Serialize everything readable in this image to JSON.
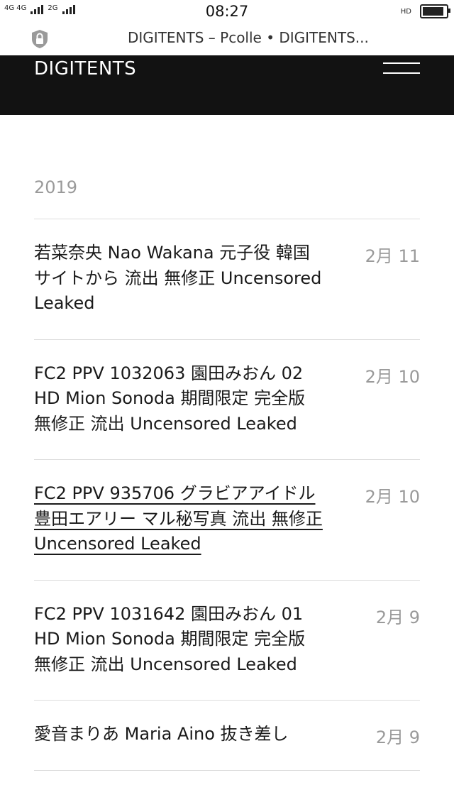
{
  "status_bar": {
    "network_left": "4G 4G",
    "network_right": "2G",
    "time": "08:27",
    "hd_label": "HD"
  },
  "browser": {
    "tab_title": "DIGITENTS – Pcolle • DIGITENTS..."
  },
  "site": {
    "logo": "DIGITENTS",
    "menu_icon": "hamburger-menu-icon"
  },
  "archive": {
    "year": "2019",
    "entries": [
      {
        "title": "若菜奈央 Nao Wakana 元子役 韓国サイトから 流出 無修正 Uncensored Leaked",
        "date": "2月 11"
      },
      {
        "title": "FC2 PPV 1032063 園田みおん 02 HD Mion Sonoda 期間限定 完全版 無修正 流出 Uncensored Leaked",
        "date": "2月 10"
      },
      {
        "title": "FC2 PPV 935706 グラビアアイドル 豊田エアリー マル秘写真 流出 無修正 Uncensored Leaked",
        "date": "2月 10"
      },
      {
        "title": "FC2 PPV 1031642 園田みおん 01 HD Mion Sonoda 期間限定 完全版 無修正 流出 Uncensored Leaked",
        "date": "2月 9"
      },
      {
        "title": "愛音まりあ Maria Aino 抜き差し",
        "date": "2月 9"
      }
    ]
  }
}
